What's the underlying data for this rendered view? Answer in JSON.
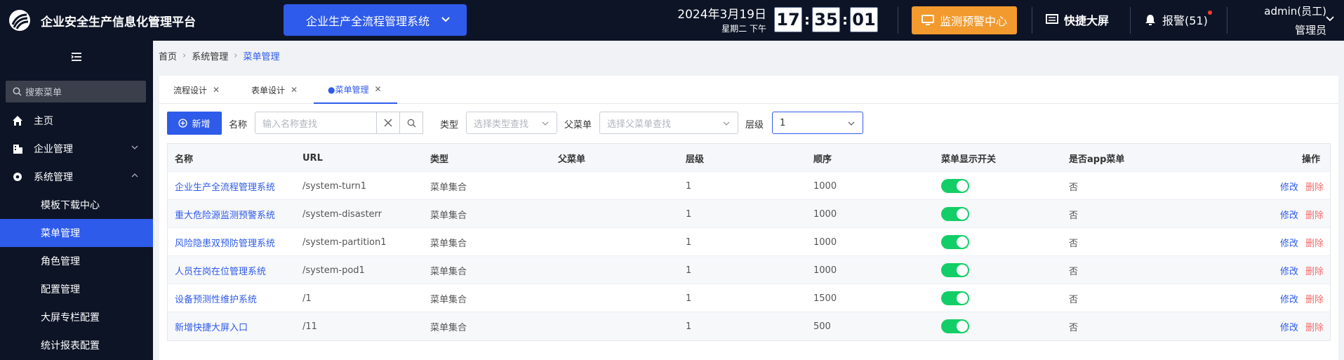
{
  "header": {
    "app_title": "企业安全生产信息化管理平台",
    "system_select": "企业生产全流程管理系统",
    "date": "2024年3月19日",
    "weekday": "星期二 下午",
    "clock": {
      "h": "17",
      "m": "35",
      "s": "01",
      "sep": ":"
    },
    "monitor_btn": "监测预警中心",
    "screen_btn": "快捷大屏",
    "alarm": "报警(51)",
    "user_name": "admin(员工)",
    "user_role": "管理员",
    "colors": {
      "bg": "#0d1426",
      "primary": "#2f5bea",
      "warning": "#f29a2e"
    }
  },
  "sidebar": {
    "search_placeholder": "搜索菜单",
    "items": [
      {
        "label": "主页",
        "icon": "home-icon"
      },
      {
        "label": "企业管理",
        "icon": "building-icon"
      },
      {
        "label": "系统管理",
        "icon": "gear-icon"
      }
    ],
    "sub_items": [
      "模板下载中心",
      "菜单管理",
      "角色管理",
      "配置管理",
      "大屏专栏配置",
      "统计报表配置"
    ],
    "active_sub": "菜单管理"
  },
  "breadcrumb": [
    "首页",
    "系统管理",
    "菜单管理"
  ],
  "tabs": [
    {
      "label": "流程设计",
      "active": false
    },
    {
      "label": "表单设计",
      "active": false
    },
    {
      "label": "●菜单管理",
      "active": true
    }
  ],
  "toolbar": {
    "add_label": "新增",
    "name_label": "名称",
    "name_placeholder": "输入名称查找",
    "type_label": "类型",
    "type_placeholder": "选择类型查找",
    "parent_label": "父菜单",
    "parent_placeholder": "选择父菜单查找",
    "level_label": "层级",
    "level_value": "1"
  },
  "table": {
    "columns": [
      "名称",
      "URL",
      "类型",
      "父菜单",
      "层级",
      "顺序",
      "菜单显示开关",
      "是否app菜单",
      "操作"
    ],
    "rows": [
      {
        "name": "企业生产全流程管理系统",
        "url": "/system-turn1",
        "type": "菜单集合",
        "parent": "",
        "level": "1",
        "order": "1000",
        "show": true,
        "app": "否"
      },
      {
        "name": "重大危险源监测预警系统",
        "url": "/system-disasterr",
        "type": "菜单集合",
        "parent": "",
        "level": "1",
        "order": "1000",
        "show": true,
        "app": "否"
      },
      {
        "name": "风险隐患双预防管理系统",
        "url": "/system-partition1",
        "type": "菜单集合",
        "parent": "",
        "level": "1",
        "order": "1000",
        "show": true,
        "app": "否"
      },
      {
        "name": "人员在岗在位管理系统",
        "url": "/system-pod1",
        "type": "菜单集合",
        "parent": "",
        "level": "1",
        "order": "1000",
        "show": true,
        "app": "否"
      },
      {
        "name": "设备预测性维护系统",
        "url": "/1",
        "type": "菜单集合",
        "parent": "",
        "level": "1",
        "order": "1500",
        "show": true,
        "app": "否"
      },
      {
        "name": "新增快捷大屏入口",
        "url": "/11",
        "type": "菜单集合",
        "parent": "",
        "level": "1",
        "order": "500",
        "show": true,
        "app": "否"
      }
    ],
    "edit_label": "修改",
    "delete_label": "删除"
  }
}
